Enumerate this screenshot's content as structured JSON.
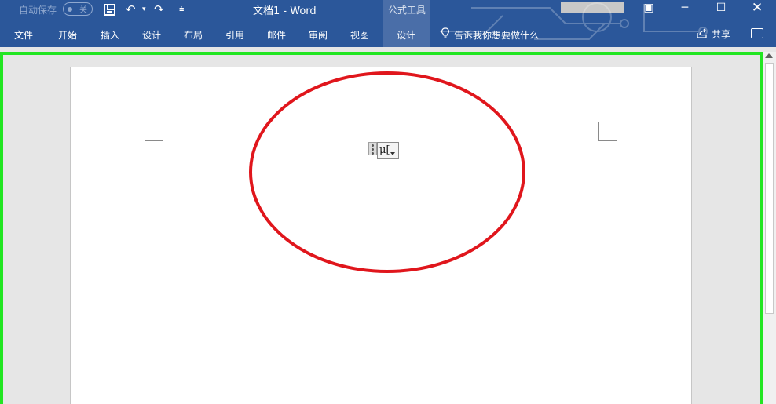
{
  "titlebar": {
    "autosave_label": "自动保存",
    "autosave_state": "关",
    "document_title": "文档1  -  Word",
    "context_group_title": "公式工具"
  },
  "ribbon": {
    "tabs": [
      "文件",
      "开始",
      "插入",
      "设计",
      "布局",
      "引用",
      "邮件",
      "审阅",
      "视图",
      "设计"
    ],
    "tell_me": "告诉我你想要做什么",
    "share": "共享"
  },
  "equation": {
    "placeholder_text": "μ[",
    "cursor": "I"
  },
  "colors": {
    "titlebar_bg": "#2b579a",
    "highlight_border": "#22e622",
    "annotation_circle": "#e0161c"
  },
  "icons": {
    "save": "save-icon",
    "undo": "undo-icon",
    "redo": "redo-icon",
    "customize": "customize-qat-icon",
    "ribbon_display": "ribbon-display-options-icon",
    "minimize": "minimize-icon",
    "maximize": "maximize-icon",
    "close": "close-icon",
    "tell_me": "lightbulb-icon",
    "share": "share-icon",
    "comments": "comment-icon"
  }
}
